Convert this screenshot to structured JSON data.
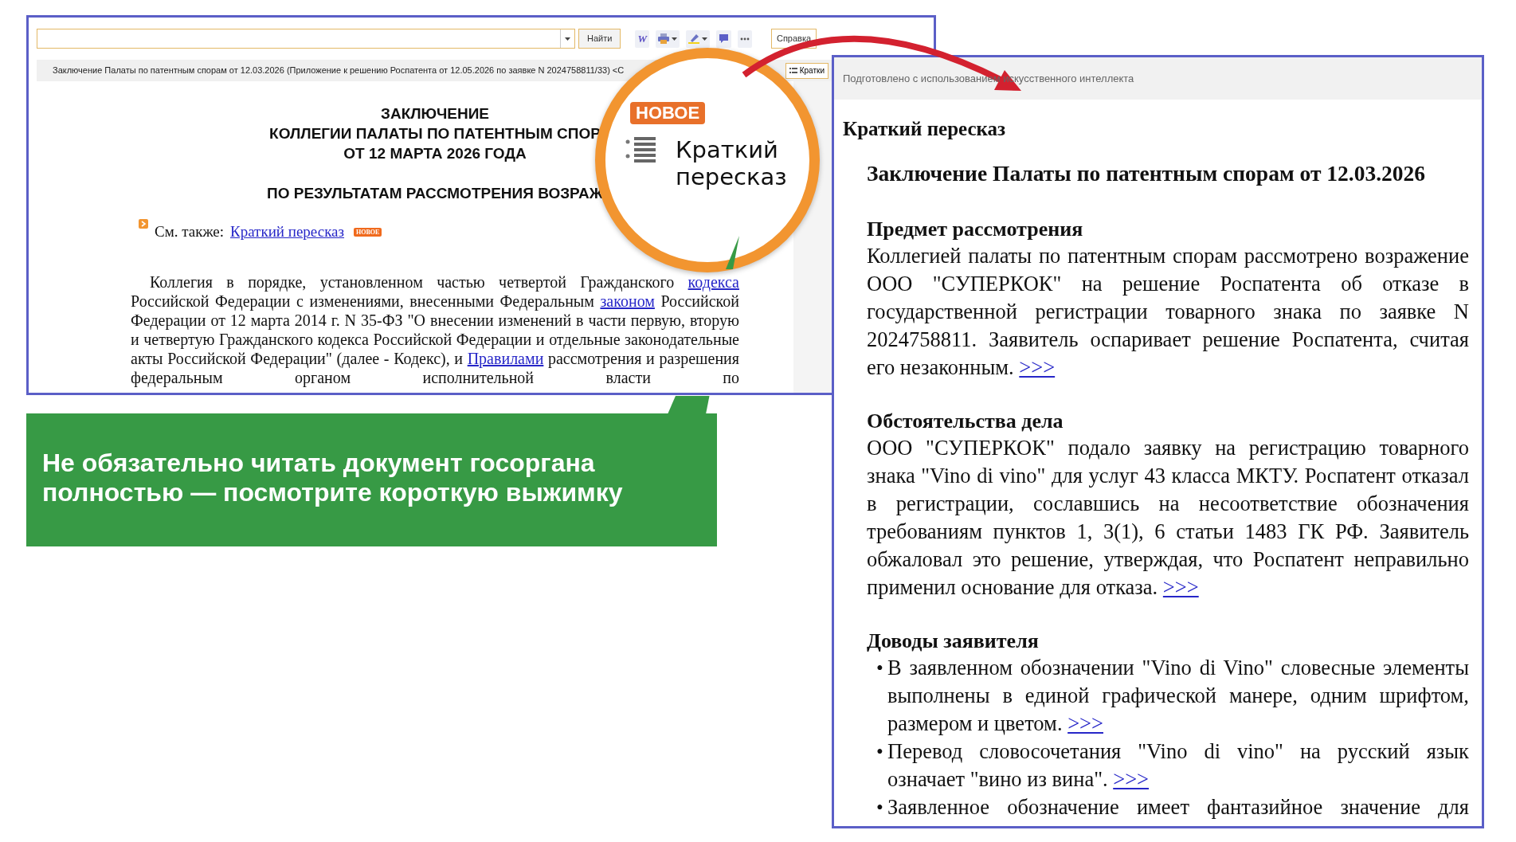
{
  "doc_window": {
    "search_button": "Найти",
    "toolbar": [
      {
        "kind": "text",
        "label": "W"
      },
      {
        "kind": "printer",
        "caret": true
      },
      {
        "kind": "highlighter",
        "caret": true
      },
      {
        "kind": "comment"
      },
      {
        "kind": "more"
      }
    ],
    "help_button": "Справка",
    "document_title": "Заключение Палаты по патентным спорам от 12.03.2026 (Приложение к решению Роспатента от 12.05.2026 по заявке N 2024758811/33) <С",
    "summary_button": "Кратки",
    "headings": [
      "ЗАКЛЮЧЕНИЕ",
      "КОЛЛЕГИИ ПАЛАТЫ ПО ПАТЕНТНЫМ СПОР",
      "ОТ 12 МАРТА 2026 ГОДА"
    ],
    "subheading": "ПО РЕЗУЛЬТАТАМ РАССМОТРЕНИЯ ВОЗРАЖ",
    "see_also": {
      "label": "См. также:",
      "link": "Краткий пересказ",
      "badge": "НОВОЕ"
    },
    "paragraph": [
      {
        "text": "Коллегия в порядке, установленном частью четвертой Гражданского ",
        "link": false
      },
      {
        "text": "кодекса",
        "link": true
      },
      {
        "text": " Российской Федерации с изменениями, внесенными Федеральным ",
        "link": false
      },
      {
        "text": "законом",
        "link": true
      },
      {
        "text": " Российской Федерации от 12 марта 2014 г. N 35-ФЗ \"О внесении изменений в части первую, вторую и четвертую Гражданского кодекса Российской Федерации и отдельные законодательные акты Российской Федерации\" (далее - Кодекс), и ",
        "link": false
      },
      {
        "text": "Правилами",
        "link": true
      },
      {
        "text": " рассмотрения и разрешения федеральным органом исполнительной власти по",
        "link": false
      }
    ]
  },
  "magnifier": {
    "badge": "НОВОЕ",
    "label": "Краткий пересказ"
  },
  "callout": {
    "text": "Не обязательно читать документ госоргана полностью — посмотрите короткую выжимку"
  },
  "summary_panel": {
    "notice": "Подготовлено с использованием искусственного интеллекта",
    "heading": "Краткий пересказ",
    "title": "Заключение Палаты по патентным спорам от 12.03.2026",
    "sections": [
      {
        "heading": "Предмет рассмотрения",
        "kind": "paragraph",
        "items": [
          {
            "text": "Коллегией палаты по патентным спорам рассмотрено возражение ООО \"СУПЕРКОК\" на решение Роспатента об отказе в государственной регистрации товарного знака по заявке N 2024758811. Заявитель оспаривает решение Роспатента, считая его незаконным.",
            "link": ">>>"
          }
        ]
      },
      {
        "heading": "Обстоятельства дела",
        "kind": "paragraph",
        "items": [
          {
            "text": "ООО \"СУПЕРКОК\" подало заявку на регистрацию товарного знака \"Vino di vino\" для услуг 43 класса МКТУ. Роспатент отказал в регистрации, сославшись на несоответствие обозначения требованиям пунктов 1, 3(1), 6 статьи 1483 ГК РФ. Заявитель обжаловал это решение, утверждая, что Роспатент неправильно применил основание для отказа.",
            "link": ">>>"
          }
        ]
      },
      {
        "heading": "Доводы заявителя",
        "kind": "bullets",
        "items": [
          {
            "bullet": "•",
            "text": "В заявленном обозначении \"Vino di Vino\" словесные элементы выполнены в единой графической манере, одним шрифтом, размером и цветом.",
            "link": ">>>"
          },
          {
            "bullet": "•",
            "text": "Перевод словосочетания \"Vino di vino\" на русский язык означает \"вино из вина\".",
            "link": ">>>"
          },
          {
            "bullet": "•",
            "text": "Заявленное обозначение имеет фантазийное значение для"
          }
        ]
      }
    ]
  }
}
